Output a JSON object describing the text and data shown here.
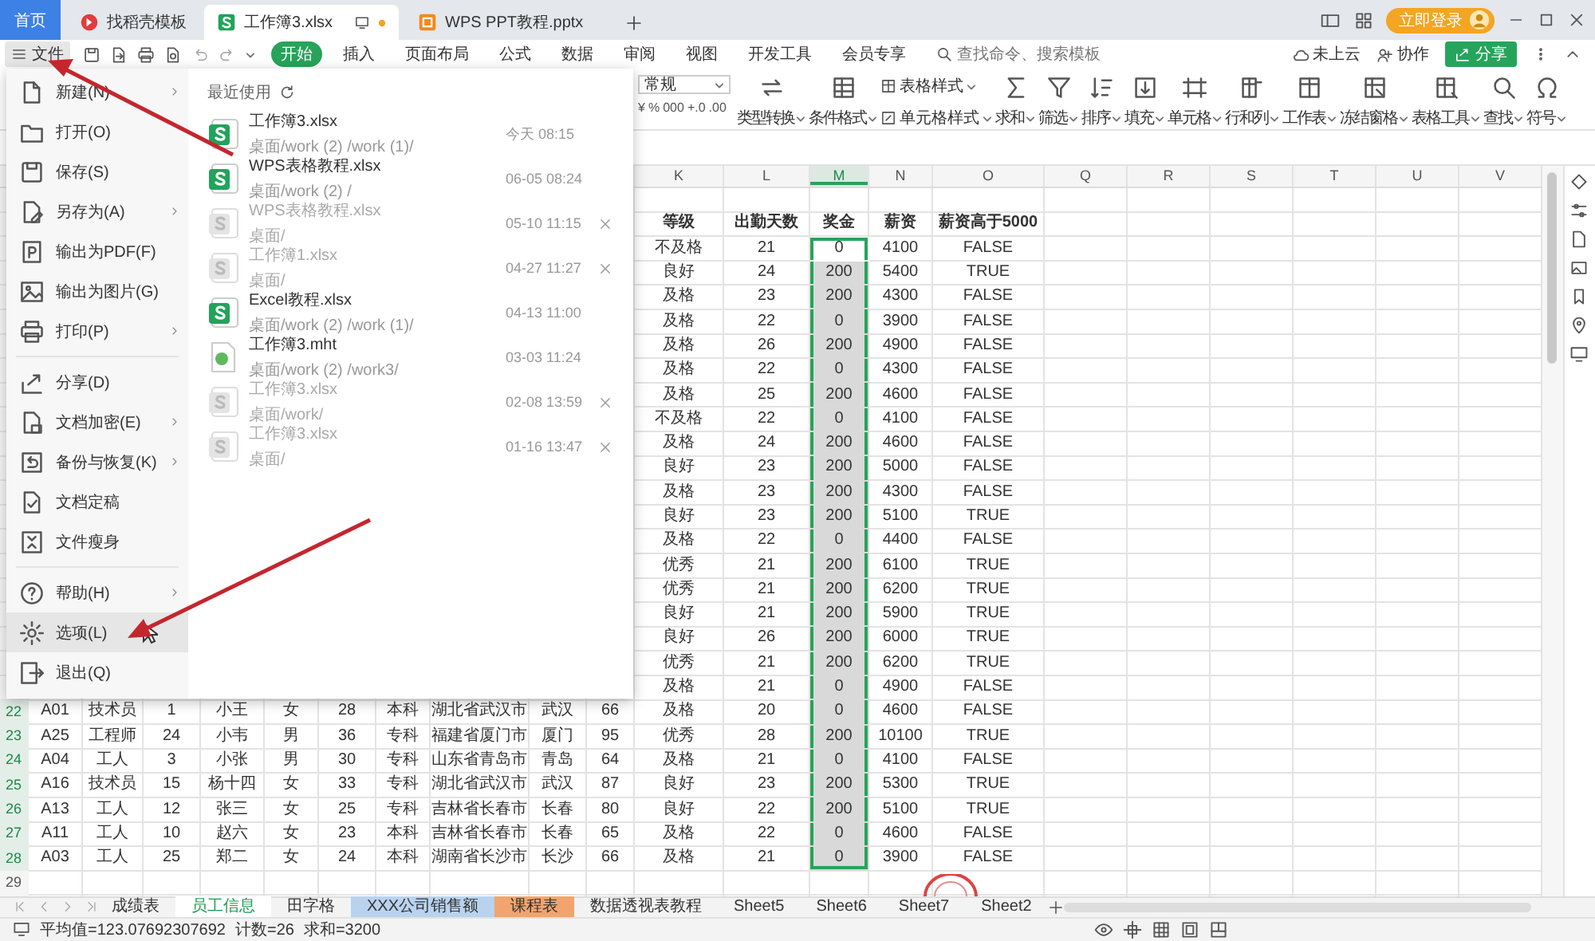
{
  "tabs": [
    {
      "label": "首页",
      "kind": "home",
      "selected": false
    },
    {
      "label": "找稻壳模板",
      "kind": "template",
      "selected": false
    },
    {
      "label": "工作簿3.xlsx",
      "kind": "sheet",
      "selected": true
    },
    {
      "label": "WPS PPT教程.pptx",
      "kind": "slides",
      "selected": false
    }
  ],
  "account": {
    "login": "立即登录"
  },
  "menu_bar": {
    "file": "文件",
    "items": [
      {
        "label": "开始",
        "selected": true
      },
      {
        "label": "插入",
        "selected": false
      },
      {
        "label": "页面布局",
        "selected": false
      },
      {
        "label": "公式",
        "selected": false
      },
      {
        "label": "数据",
        "selected": false
      },
      {
        "label": "审阅",
        "selected": false
      },
      {
        "label": "视图",
        "selected": false
      },
      {
        "label": "开发工具",
        "selected": false
      },
      {
        "label": "会员专享",
        "selected": false
      }
    ],
    "search": {
      "placeholder": "查找命令、搜索模板"
    },
    "cloud": "未上云",
    "collab": "协作",
    "share": "分享"
  },
  "ribbon": {
    "number_format": "常规",
    "format_buttons": [
      "¥",
      "%",
      "000",
      "+.0",
      ".00"
    ],
    "tools": [
      {
        "kind": "convert",
        "label": "类型转换"
      },
      {
        "kind": "conditional",
        "label": "条件格式"
      },
      {
        "kind": "pair",
        "labels": [
          "表格样式",
          "单元格样式"
        ]
      },
      {
        "kind": "sum",
        "label": "求和"
      },
      {
        "kind": "filter",
        "label": "筛选"
      },
      {
        "kind": "sort",
        "label": "排序"
      },
      {
        "kind": "fill",
        "label": "填充"
      },
      {
        "kind": "cell",
        "label": "单元格"
      },
      {
        "kind": "rowcol",
        "label": "行和列"
      },
      {
        "kind": "sheet",
        "label": "工作表"
      },
      {
        "kind": "freeze",
        "label": "冻结窗格"
      },
      {
        "kind": "tools",
        "label": "表格工具"
      },
      {
        "kind": "find",
        "label": "查找"
      },
      {
        "kind": "symbol",
        "label": "符号"
      }
    ]
  },
  "file_menu": {
    "command_groups": [
      [
        {
          "label": "新建(N)",
          "submenu": true,
          "hovered": false
        },
        {
          "label": "打开(O)",
          "submenu": false,
          "hovered": false
        },
        {
          "label": "保存(S)",
          "submenu": false,
          "hovered": false
        },
        {
          "label": "另存为(A)",
          "submenu": true,
          "hovered": false
        },
        {
          "label": "输出为PDF(F)",
          "submenu": false,
          "hovered": false
        },
        {
          "label": "输出为图片(G)",
          "submenu": false,
          "hovered": false
        },
        {
          "label": "打印(P)",
          "submenu": true,
          "hovered": false
        }
      ],
      [
        {
          "label": "分享(D)",
          "submenu": false,
          "hovered": false
        },
        {
          "label": "文档加密(E)",
          "submenu": true,
          "hovered": false
        },
        {
          "label": "备份与恢复(K)",
          "submenu": true,
          "hovered": false
        },
        {
          "label": "文档定稿",
          "submenu": false,
          "hovered": false
        },
        {
          "label": "文件瘦身",
          "submenu": false,
          "hovered": false
        }
      ],
      [
        {
          "label": "帮助(H)",
          "submenu": true,
          "hovered": false
        },
        {
          "label": "选项(L)",
          "submenu": false,
          "hovered": true
        },
        {
          "label": "退出(Q)",
          "submenu": false,
          "hovered": false
        }
      ]
    ],
    "recent": {
      "title": "最近使用",
      "files": [
        {
          "name": "工作簿3.xlsx",
          "path": "桌面/work (2) /work (1)/",
          "time": "今天 08:15",
          "kind": "xlsx",
          "removable": false
        },
        {
          "name": "WPS表格教程.xlsx",
          "path": "桌面/work (2) /",
          "time": "06-05 08:24",
          "kind": "xlsx",
          "removable": false
        },
        {
          "name": "WPS表格教程.xlsx",
          "path": "桌面/",
          "time": "05-10 11:15",
          "kind": "missing",
          "removable": true
        },
        {
          "name": "工作簿1.xlsx",
          "path": "桌面/",
          "time": "04-27 11:27",
          "kind": "missing",
          "removable": true
        },
        {
          "name": "Excel教程.xlsx",
          "path": "桌面/work (2) /work (1)/",
          "time": "04-13 11:00",
          "kind": "xlsx",
          "removable": false
        },
        {
          "name": "工作簿3.mht",
          "path": "桌面/work (2) /work3/",
          "time": "03-03 11:24",
          "kind": "mht",
          "removable": false
        },
        {
          "name": "工作簿3.xlsx",
          "path": "桌面/work/",
          "time": "02-08 13:59",
          "kind": "missing",
          "removable": true
        },
        {
          "name": "工作簿3.xlsx",
          "path": "桌面/",
          "time": "01-16 13:47",
          "kind": "missing",
          "removable": true
        }
      ]
    }
  },
  "sheet": {
    "columns": [
      {
        "label": "K",
        "selected": false
      },
      {
        "label": "L",
        "selected": false
      },
      {
        "label": "M",
        "selected": true
      },
      {
        "label": "N",
        "selected": false
      },
      {
        "label": "O",
        "selected": false
      },
      {
        "label": "Q",
        "selected": false
      },
      {
        "label": "R",
        "selected": false
      },
      {
        "label": "S",
        "selected": false
      },
      {
        "label": "T",
        "selected": false
      },
      {
        "label": "U",
        "selected": false
      },
      {
        "label": "V",
        "selected": false
      }
    ],
    "rows": [
      {
        "kind": "header",
        "selected": false,
        "active": false,
        "cells": [
          "等级",
          "出勤天数",
          "奖金",
          "薪资",
          "薪资高于5000"
        ]
      },
      {
        "kind": "data",
        "selected": true,
        "active": true,
        "cells": [
          "不及格",
          "21",
          "0",
          "4100",
          "FALSE"
        ]
      },
      {
        "kind": "data",
        "selected": true,
        "active": false,
        "cells": [
          "良好",
          "24",
          "200",
          "5400",
          "TRUE"
        ]
      },
      {
        "kind": "data",
        "selected": true,
        "active": false,
        "cells": [
          "及格",
          "23",
          "200",
          "4300",
          "FALSE"
        ]
      },
      {
        "kind": "data",
        "selected": true,
        "active": false,
        "cells": [
          "及格",
          "22",
          "0",
          "3900",
          "FALSE"
        ]
      },
      {
        "kind": "data",
        "selected": true,
        "active": false,
        "cells": [
          "及格",
          "26",
          "200",
          "4900",
          "FALSE"
        ]
      },
      {
        "kind": "data",
        "selected": true,
        "active": false,
        "cells": [
          "及格",
          "22",
          "0",
          "4300",
          "FALSE"
        ]
      },
      {
        "kind": "data",
        "selected": true,
        "active": false,
        "cells": [
          "及格",
          "25",
          "200",
          "4600",
          "FALSE"
        ]
      },
      {
        "kind": "data",
        "selected": true,
        "active": false,
        "cells": [
          "不及格",
          "22",
          "0",
          "4100",
          "FALSE"
        ]
      },
      {
        "kind": "data",
        "selected": true,
        "active": false,
        "cells": [
          "及格",
          "24",
          "200",
          "4600",
          "FALSE"
        ]
      },
      {
        "kind": "data",
        "selected": true,
        "active": false,
        "cells": [
          "良好",
          "23",
          "200",
          "5000",
          "FALSE"
        ]
      },
      {
        "kind": "data",
        "selected": true,
        "active": false,
        "cells": [
          "及格",
          "23",
          "200",
          "4300",
          "FALSE"
        ]
      },
      {
        "kind": "data",
        "selected": true,
        "active": false,
        "cells": [
          "良好",
          "23",
          "200",
          "5100",
          "TRUE"
        ]
      },
      {
        "kind": "data",
        "selected": true,
        "active": false,
        "cells": [
          "及格",
          "22",
          "0",
          "4400",
          "FALSE"
        ]
      },
      {
        "kind": "data",
        "selected": true,
        "active": false,
        "cells": [
          "优秀",
          "21",
          "200",
          "6100",
          "TRUE"
        ]
      },
      {
        "kind": "data",
        "selected": true,
        "active": false,
        "cells": [
          "优秀",
          "21",
          "200",
          "6200",
          "TRUE"
        ]
      },
      {
        "kind": "data",
        "selected": true,
        "active": false,
        "cells": [
          "良好",
          "21",
          "200",
          "5900",
          "TRUE"
        ]
      },
      {
        "kind": "data",
        "selected": true,
        "active": false,
        "cells": [
          "良好",
          "26",
          "200",
          "6000",
          "TRUE"
        ]
      },
      {
        "kind": "data",
        "selected": true,
        "active": false,
        "cells": [
          "优秀",
          "21",
          "200",
          "6200",
          "TRUE"
        ]
      },
      {
        "kind": "data",
        "selected": true,
        "active": false,
        "cells": [
          "及格",
          "21",
          "0",
          "4900",
          "FALSE"
        ]
      },
      {
        "number": "22",
        "kind": "data",
        "selected": true,
        "active": false,
        "cells": [
          "A01",
          "技术员",
          "1",
          "小王",
          "女",
          "28",
          "本科",
          "湖北省武汉市",
          "武汉",
          "66",
          "及格",
          "20",
          "0",
          "4600",
          "FALSE"
        ]
      },
      {
        "number": "23",
        "kind": "data",
        "selected": true,
        "active": false,
        "cells": [
          "A25",
          "工程师",
          "24",
          "小韦",
          "男",
          "36",
          "专科",
          "福建省厦门市",
          "厦门",
          "95",
          "优秀",
          "28",
          "200",
          "10100",
          "TRUE"
        ]
      },
      {
        "number": "24",
        "kind": "data",
        "selected": true,
        "active": false,
        "cells": [
          "A04",
          "工人",
          "3",
          "小张",
          "男",
          "30",
          "专科",
          "山东省青岛市",
          "青岛",
          "64",
          "及格",
          "21",
          "0",
          "4100",
          "FALSE"
        ]
      },
      {
        "number": "25",
        "kind": "data",
        "selected": true,
        "active": false,
        "cells": [
          "A16",
          "技术员",
          "15",
          "杨十四",
          "女",
          "33",
          "专科",
          "湖北省武汉市",
          "武汉",
          "87",
          "良好",
          "23",
          "200",
          "5300",
          "TRUE"
        ]
      },
      {
        "number": "26",
        "kind": "data",
        "selected": true,
        "active": false,
        "cells": [
          "A13",
          "工人",
          "12",
          "张三",
          "女",
          "25",
          "专科",
          "吉林省长春市",
          "长春",
          "80",
          "良好",
          "22",
          "200",
          "5100",
          "TRUE"
        ]
      },
      {
        "number": "27",
        "kind": "data",
        "selected": true,
        "active": false,
        "cells": [
          "A11",
          "工人",
          "10",
          "赵六",
          "女",
          "23",
          "本科",
          "吉林省长春市",
          "长春",
          "65",
          "及格",
          "22",
          "0",
          "4600",
          "FALSE"
        ]
      },
      {
        "number": "28",
        "kind": "data",
        "selected": true,
        "active": false,
        "cells": [
          "A03",
          "工人",
          "25",
          "郑二",
          "女",
          "24",
          "本科",
          "湖南省长沙市",
          "长沙",
          "66",
          "及格",
          "21",
          "0",
          "3900",
          "FALSE"
        ]
      },
      {
        "number": "29",
        "kind": "data",
        "selected": false,
        "active": false,
        "cells": []
      }
    ]
  },
  "sheet_tabs": [
    {
      "label": "成绩表",
      "selected": false
    },
    {
      "label": "员工信息",
      "selected": true
    },
    {
      "label": "田字格",
      "selected": false
    },
    {
      "label": "XXX公司销售额",
      "selected": false,
      "color": "#b9d3ef"
    },
    {
      "label": "课程表",
      "selected": false,
      "color": "#f2a46f"
    },
    {
      "label": "数据透视表教程",
      "selected": false
    },
    {
      "label": "Sheet5",
      "selected": false
    },
    {
      "label": "Sheet6",
      "selected": false
    },
    {
      "label": "Sheet7",
      "selected": false
    },
    {
      "label": "Sheet2",
      "selected": false
    }
  ],
  "status_bar": {
    "average": "平均值=123.07692307692",
    "count": "计数=26",
    "sum": "求和=3200"
  }
}
